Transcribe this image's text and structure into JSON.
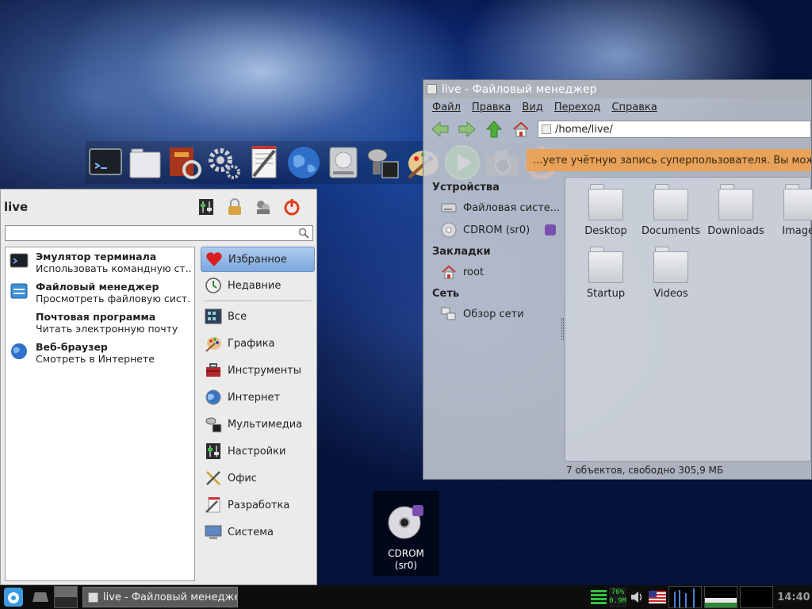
{
  "dock": {
    "items": [
      {
        "name": "terminal-icon"
      },
      {
        "name": "files-icon"
      },
      {
        "name": "package-manager-icon"
      },
      {
        "name": "settings-gear-icon"
      },
      {
        "name": "text-editor-icon"
      },
      {
        "name": "web-browser-globe-icon"
      },
      {
        "name": "disk-icon"
      },
      {
        "name": "media-player-icon"
      },
      {
        "name": "paint-palette-icon"
      },
      {
        "name": "play-icon"
      },
      {
        "name": "camera-icon"
      },
      {
        "name": "power-icon"
      }
    ]
  },
  "file_manager": {
    "title": "live - Файловый менеджер",
    "menu": [
      "Файл",
      "Правка",
      "Вид",
      "Переход",
      "Справка"
    ],
    "path": "/home/live/",
    "warning": "...уете учётную запись суперпользователя. Вы можете",
    "sidebar": {
      "devices_heading": "Устройства",
      "devices": [
        {
          "label": "Файловая систе...",
          "icon": "drive-icon"
        },
        {
          "label": "CDROM (sr0)",
          "icon": "cdrom-icon"
        }
      ],
      "bookmarks_heading": "Закладки",
      "bookmarks": [
        {
          "label": "root",
          "icon": "home-icon"
        }
      ],
      "network_heading": "Сеть",
      "network": [
        {
          "label": "Обзор сети",
          "icon": "network-icon"
        }
      ]
    },
    "files": [
      "Desktop",
      "Documents",
      "Downloads",
      "Images",
      "Startup",
      "Videos"
    ],
    "status": "7 объектов, свободно 305,9 МБ"
  },
  "app_menu": {
    "user": "live",
    "search_placeholder": "",
    "favorites": [
      {
        "title": "Эмулятор терминала",
        "desc": "Использовать командную ст...",
        "icon": "terminal-icon"
      },
      {
        "title": "Файловый менеджер",
        "desc": "Просмотреть файловую сист...",
        "icon": "file-manager-icon"
      },
      {
        "title": "Почтовая программа",
        "desc": "Читать электронную почту",
        "icon": "mail-icon"
      },
      {
        "title": "Веб-браузер",
        "desc": "Смотреть в Интернете",
        "icon": "globe-icon"
      }
    ],
    "categories_top": [
      {
        "label": "Избранное",
        "icon": "heart-icon"
      },
      {
        "label": "Недавние",
        "icon": "recent-clock-icon"
      }
    ],
    "categories": [
      {
        "label": "Все",
        "icon": "all-apps-icon"
      },
      {
        "label": "Графика",
        "icon": "graphics-icon"
      },
      {
        "label": "Инструменты",
        "icon": "toolbox-icon"
      },
      {
        "label": "Интернет",
        "icon": "internet-icon"
      },
      {
        "label": "Мультимедиа",
        "icon": "multimedia-icon"
      },
      {
        "label": "Настройки",
        "icon": "settings-icon"
      },
      {
        "label": "Офис",
        "icon": "office-icon"
      },
      {
        "label": "Разработка",
        "icon": "development-icon"
      },
      {
        "label": "Система",
        "icon": "system-icon"
      }
    ]
  },
  "desktop": {
    "cdrom_label_1": "CDROM",
    "cdrom_label_2": "(sr0)"
  },
  "taskbar": {
    "task_label": "live - Файловый менеджер",
    "cpu_line1": "76%",
    "cpu_line2": "0.9M",
    "clock": "14:40"
  },
  "colors": {
    "warning_bg": "#e8a25a",
    "selection": "#7da7dc",
    "taskbar_bg": "#0d0d0d"
  }
}
